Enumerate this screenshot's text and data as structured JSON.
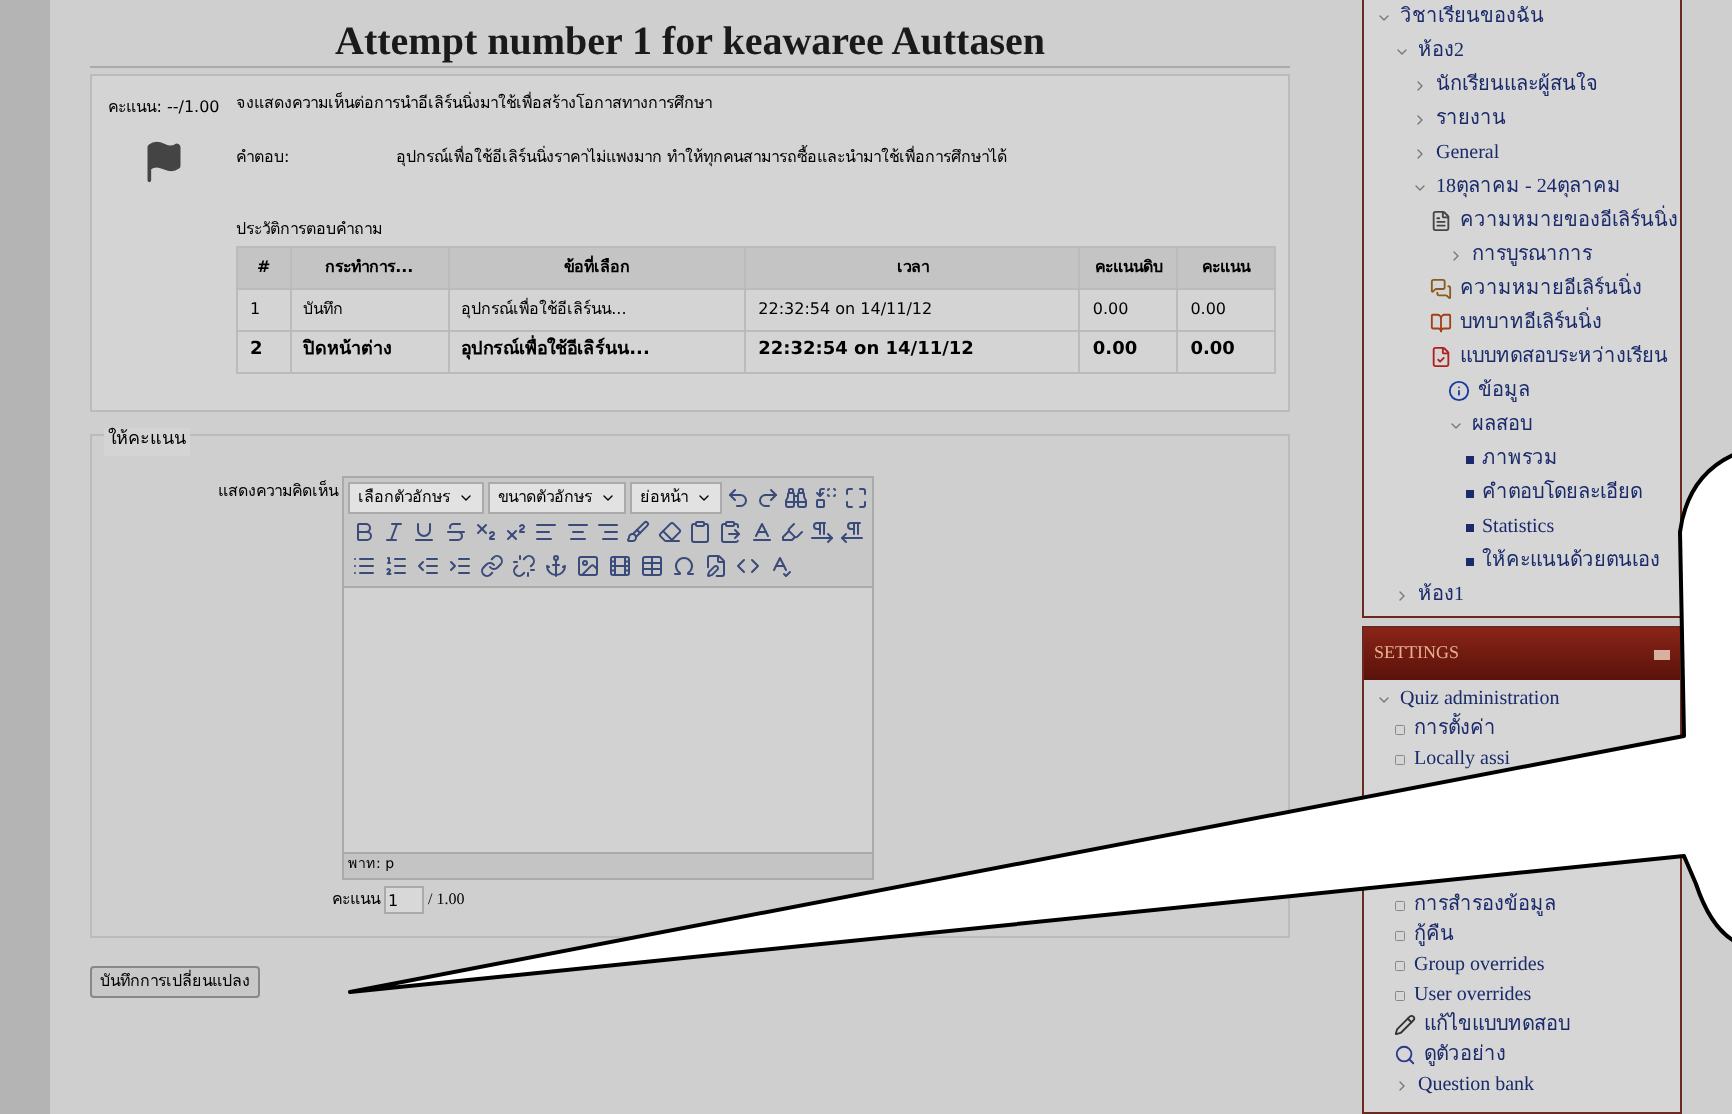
{
  "title": "Attempt number 1 for keawaree Auttasen",
  "question": {
    "grade": "คะแนน: --/1.00",
    "flagged": true,
    "text": "จงแสดงความเห็นต่อการนำอีเลิร์นนิ่งมาใช้เพื่อสร้างโอกาสทางการศึกษา",
    "answer_label": "คำตอบ:",
    "answer": "อุปกรณ์เพื่อใช้อีเลิร์นนิ่งราคาไม่แพงมาก ทำให้ทุกคนสามารถซื้อและนำมาใช้เพื่อการศึกษาได้",
    "history": {
      "label": "ประวัติการตอบคำถาม",
      "columns": [
        "#",
        "กระทำการ...",
        "ข้อที่เลือก",
        "เวลา",
        "คะแนนดิบ",
        "คะแนน"
      ],
      "rows": [
        {
          "current": false,
          "cells": [
            "1",
            "บันทึก",
            "อุปกรณ์เพื่อใช้อีเลิร์นน...",
            "22:32:54 on 14/11/12",
            "0.00",
            "0.00"
          ]
        },
        {
          "current": true,
          "cells": [
            "2",
            "ปิดหน้าต่าง",
            "อุปกรณ์เพื่อใช้อีเลิร์นน...",
            "22:32:54 on 14/11/12",
            "0.00",
            "0.00"
          ]
        }
      ]
    }
  },
  "grading": {
    "legend": "ให้คะแนน",
    "comment_label": "แสดงความคิดเห็น",
    "font_family": "เลือกตัวอักษร",
    "font_size": "ขนาดตัวอักษร",
    "paragraph": "ย่อหน้า",
    "path": "พาท: p",
    "mark_label": "คะแนน",
    "mark_value": "1",
    "mark_max": "/ 1.00"
  },
  "save_button": "บันทึกการเปลี่ยนแปลง",
  "navigation": [
    {
      "label": "วิชาเรียนของฉัน",
      "kind": "branch",
      "expanded": true,
      "children": [
        {
          "label": "ห้อง2",
          "kind": "branch",
          "expanded": true,
          "children": [
            {
              "label": "นักเรียนและผู้สนใจ",
              "kind": "branch",
              "expanded": false
            },
            {
              "label": "รายงาน",
              "kind": "branch",
              "expanded": false
            },
            {
              "label": "General",
              "kind": "branch",
              "expanded": false
            },
            {
              "label": "18ตุลาคม - 24ตุลาคม",
              "kind": "branch",
              "expanded": true,
              "children": [
                {
                  "label": "ความหมายของอีเลิร์นนิ่ง",
                  "kind": "page",
                  "children": [
                    {
                      "label": "การบูรณาการ",
                      "kind": "branch",
                      "expanded": false
                    }
                  ]
                },
                {
                  "label": "ความหมายอีเลิร์นนิ่ง",
                  "kind": "forum"
                },
                {
                  "label": "บทบาทอีเลิร์นนิ่ง",
                  "kind": "resource"
                },
                {
                  "label": "แบบทดสอบระหว่างเรียน",
                  "kind": "quiz",
                  "children": [
                    {
                      "label": "ข้อมูล",
                      "kind": "info"
                    },
                    {
                      "label": "ผลสอบ",
                      "kind": "branch",
                      "expanded": true,
                      "children": [
                        {
                          "label": "ภาพรวม",
                          "kind": "leaf"
                        },
                        {
                          "label": "คำตอบโดยละเอียด",
                          "kind": "leaf"
                        },
                        {
                          "label": "Statistics",
                          "kind": "leaf"
                        },
                        {
                          "label": "ให้คะแนนด้วยตนเอง",
                          "kind": "leaf"
                        }
                      ]
                    }
                  ]
                }
              ]
            }
          ]
        },
        {
          "label": "ห้อง1",
          "kind": "branch",
          "expanded": false
        }
      ]
    }
  ],
  "settings": {
    "title": "SETTINGS",
    "items": [
      {
        "label": "Quiz administration",
        "kind": "branch",
        "expanded": true,
        "children": [
          {
            "label": "การตั้งค่า",
            "kind": "square"
          },
          {
            "label": "Locally assi",
            "kind": "square"
          },
          {
            "label": "การสำรองข้อมูล",
            "kind": "square"
          },
          {
            "label": "กู้คืน",
            "kind": "square"
          },
          {
            "label": "Group overrides",
            "kind": "square"
          },
          {
            "label": "User overrides",
            "kind": "square"
          },
          {
            "label": "แก้ไขแบบทดสอบ",
            "kind": "edit"
          },
          {
            "label": "ดูตัวอย่าง",
            "kind": "preview"
          },
          {
            "label": "Question bank",
            "kind": "branch",
            "expanded": false
          }
        ]
      }
    ]
  }
}
